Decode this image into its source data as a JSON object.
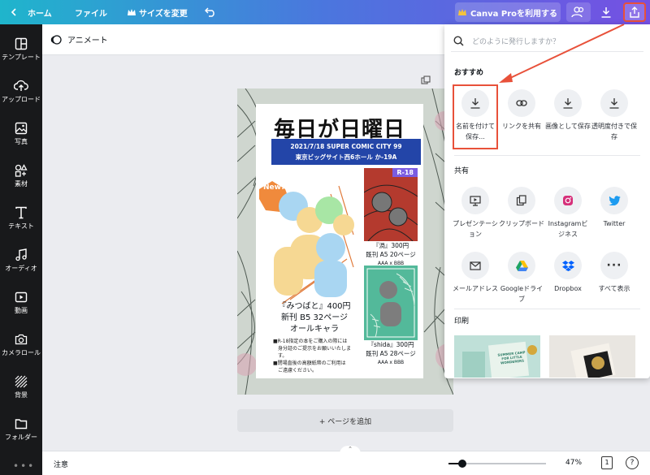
{
  "topbar": {
    "home": "ホーム",
    "file": "ファイル",
    "resize": "サイズを変更",
    "pro": "Canva Proを利用する"
  },
  "subbar": {
    "animate": "アニメート"
  },
  "sidebar": {
    "items": [
      {
        "label": "テンプレート",
        "icon": "template-icon"
      },
      {
        "label": "アップロード",
        "icon": "upload-icon"
      },
      {
        "label": "写真",
        "icon": "photo-icon"
      },
      {
        "label": "素材",
        "icon": "elements-icon"
      },
      {
        "label": "テキスト",
        "icon": "text-icon"
      },
      {
        "label": "オーディオ",
        "icon": "audio-icon"
      },
      {
        "label": "動画",
        "icon": "video-icon"
      },
      {
        "label": "カメラロール",
        "icon": "camera-icon"
      },
      {
        "label": "背景",
        "icon": "background-icon"
      },
      {
        "label": "フォルダー",
        "icon": "folder-icon"
      }
    ]
  },
  "poster": {
    "title": "毎日が日曜日",
    "event_line1": "2021/7/18 SUPER COMIC CITY 99",
    "event_line2": "東京ビッグサイト西6ホール か-19A",
    "new_badge": "New!",
    "r18_badge": "R-18",
    "book1_title": "『渦』300円",
    "book1_sub": "既刊 A5 20ページ",
    "book1_pair": "AAA x BBB",
    "main_title": "『みつばと』400円",
    "main_sub": "新刊 B5 32ページ",
    "main_desc": "オールキャラ",
    "note1": "■R-18指定の本をご購入の際には",
    "note1b": "身分証のご提示をお願いいたします。",
    "note2": "■閉場直後の高額紙幣のご利用は",
    "note2b": "ご遠慮ください。",
    "book2_title": "『shida』300円",
    "book2_sub": "既刊 A5 28ページ",
    "book2_pair": "AAA x BBB"
  },
  "canvas": {
    "add_page": "+ ページを追加"
  },
  "bottombar": {
    "notes": "注意",
    "zoom": "47%",
    "page": "1",
    "help": "?"
  },
  "share_panel": {
    "search_placeholder": "どのように発行しますか？",
    "recommended_title": "おすすめ",
    "recommended": [
      {
        "label": "名前を付けて保存...",
        "icon": "download-icon"
      },
      {
        "label": "リンクを共有",
        "icon": "link-icon"
      },
      {
        "label": "画像として保存",
        "icon": "download-icon"
      },
      {
        "label": "透明度付きで保存",
        "icon": "download-icon"
      }
    ],
    "share_title": "共有",
    "share": [
      {
        "label": "プレゼンテーション",
        "icon": "presentation-icon"
      },
      {
        "label": "クリップボード",
        "icon": "clipboard-icon"
      },
      {
        "label": "Instagramビジネス",
        "icon": "instagram-icon"
      },
      {
        "label": "Twitter",
        "icon": "twitter-icon"
      },
      {
        "label": "メールアドレス",
        "icon": "email-icon"
      },
      {
        "label": "Googleドライブ",
        "icon": "google-drive-icon"
      },
      {
        "label": "Dropbox",
        "icon": "dropbox-icon"
      },
      {
        "label": "すべて表示",
        "icon": "more-icon"
      }
    ],
    "print_title": "印刷",
    "print_card_text": "SUMMER CAMP FOR LITTLE WONDERERS"
  },
  "colors": {
    "accent": "#e8513a",
    "brand_blue": "#2345a8",
    "panel_bg": "#ffffff"
  }
}
